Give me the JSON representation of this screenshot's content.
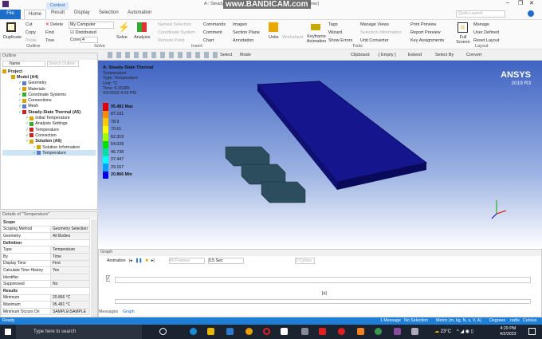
{
  "window": {
    "title": "A : Steady-State Thermal - Mechanical [ANSYS Enterprise]",
    "watermark": "www.BANDICAM.com",
    "context_tab": "Context",
    "quick_launch_placeholder": "Quick Launch"
  },
  "tabs": [
    "File",
    "Home",
    "Result",
    "Display",
    "Selection",
    "Automation"
  ],
  "ribbon": {
    "outline": {
      "label": "Outline",
      "duplicate": "Duplicate",
      "cut": "Cut",
      "copy": "Copy",
      "paste": "Paste",
      "delete": "Delete",
      "find": "Find",
      "tree": "Tree"
    },
    "solve": {
      "label": "Solve",
      "computer": "My Computer",
      "distributed": "Distributed",
      "cores_label": "Cores",
      "cores": "4",
      "solve": "Solve"
    },
    "insert": {
      "label": "Insert",
      "analysis": "Analysis",
      "named_selection": "Named Selection",
      "coordinate_system": "Coordinate System",
      "remote_point": "Remote Point",
      "commands": "Commands",
      "comment": "Comment",
      "chart": "Chart",
      "images": "Images",
      "section_plane": "Section Plane",
      "annotation": "Annotation"
    },
    "tools": {
      "label": "Tools",
      "units": "Units",
      "worksheet": "Worksheet",
      "keyframe": "Keyframe Animation",
      "tags": "Tags",
      "wizard": "Wizard",
      "show_errors": "Show Errors",
      "manage_views": "Manage Views",
      "selection_information": "Selection Information",
      "unit_converter": "Unit Converter",
      "print_preview": "Print Preview",
      "report_preview": "Report Preview",
      "key_assignments": "Key Assignments"
    },
    "layout": {
      "label": "Layout",
      "full_screen": "Full Screen",
      "manage": "Manage",
      "user_defined": "User Defined",
      "reset_layout": "Reset Layout"
    }
  },
  "toolbar": {
    "select": "Select",
    "mode": "Mode",
    "clipboard": "Clipboard",
    "empty": "[ Empty ]",
    "extend": "Extend",
    "select_by": "Select By",
    "convert": "Convert"
  },
  "outline": {
    "title": "Outline",
    "filter": "Name",
    "search_placeholder": "Search Outline",
    "items": [
      {
        "label": "Project",
        "level": 0,
        "bold": true
      },
      {
        "label": "Model (A4)",
        "level": 1,
        "bold": true
      },
      {
        "label": "Geometry",
        "level": 2
      },
      {
        "label": "Materials",
        "level": 2
      },
      {
        "label": "Coordinate Systems",
        "level": 2
      },
      {
        "label": "Connections",
        "level": 2
      },
      {
        "label": "Mesh",
        "level": 2
      },
      {
        "label": "Steady-State Thermal (A5)",
        "level": 2,
        "bold": true
      },
      {
        "label": "Initial Temperature",
        "level": 3
      },
      {
        "label": "Analysis Settings",
        "level": 3
      },
      {
        "label": "Temperature",
        "level": 3
      },
      {
        "label": "Convection",
        "level": 3
      },
      {
        "label": "Solution (A6)",
        "level": 3,
        "bold": true
      },
      {
        "label": "Solution Information",
        "level": 4
      },
      {
        "label": "Temperature",
        "level": 4
      }
    ]
  },
  "details": {
    "title": "Details of \"Temperature\"",
    "rows": [
      {
        "k": "Scope",
        "section": true
      },
      {
        "k": "Scoping Method",
        "v": "Geometry Selection"
      },
      {
        "k": "Geometry",
        "v": "All Bodies"
      },
      {
        "k": "Definition",
        "section": true
      },
      {
        "k": "Type",
        "v": "Temperature"
      },
      {
        "k": "By",
        "v": "Time"
      },
      {
        "k": "Display Time",
        "v": "First"
      },
      {
        "k": "Calculate Time History",
        "v": "Yes"
      },
      {
        "k": "Identifier",
        "v": ""
      },
      {
        "k": "Suppressed",
        "v": "No"
      },
      {
        "k": "Results",
        "section": true
      },
      {
        "k": "Minimum",
        "v": "20.866 °C"
      },
      {
        "k": "Maximum",
        "v": "95.481 °C"
      },
      {
        "k": "Minimum Occurs On",
        "v": "SAMPLE\\SAMPLE"
      }
    ]
  },
  "viewport": {
    "title": "A: Steady-State Thermal",
    "lines": [
      "Temperature",
      "Type: Temperature",
      "Unit: °C",
      "Time: 0.15385",
      "4/2/2023 4:29 PM"
    ],
    "brand": "ANSYS",
    "version": "2019 R3",
    "legend": [
      {
        "label": "95.481 Max",
        "color": "#e00000"
      },
      {
        "label": "87.191",
        "color": "#ff8c00"
      },
      {
        "label": "78.9",
        "color": "#ffc800"
      },
      {
        "label": "70.61",
        "color": "#ffff00"
      },
      {
        "label": "62.319",
        "color": "#a0ff00"
      },
      {
        "label": "54.028",
        "color": "#00e000"
      },
      {
        "label": "45.738",
        "color": "#00e0a0"
      },
      {
        "label": "37.447",
        "color": "#00ffff"
      },
      {
        "label": "29.157",
        "color": "#00a0ff"
      },
      {
        "label": "20.866 Min",
        "color": "#0000e0"
      }
    ]
  },
  "graph": {
    "title": "Graph",
    "animation": "Animation",
    "frames": "40 Frames",
    "speed": "0.5 Sec",
    "cycles": "3 Cycles",
    "ylabel": "[°C]",
    "xlabel": "[s]",
    "tabs": [
      "Messages",
      "Graph"
    ]
  },
  "status": {
    "ready": "Ready",
    "messages": "1 Message",
    "selection": "No Selection",
    "units": "Metric (m, kg, N, s, V, A)",
    "angle": "Degrees",
    "rate": "rad/s",
    "temp": "Celsius"
  },
  "taskbar": {
    "search": "Type here to search",
    "weather": "23°C",
    "time": "4:29 PM",
    "date": "4/2/2023"
  }
}
